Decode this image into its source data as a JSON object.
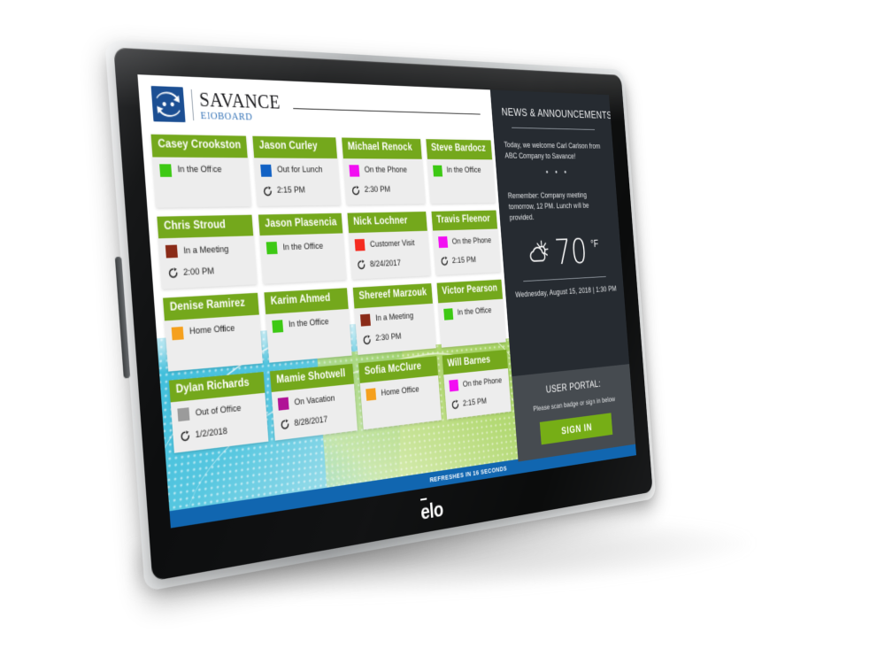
{
  "device": {
    "brand_logo": "elo-logo",
    "bezel_color": "#111213",
    "chassis_color": "#c9ccce"
  },
  "header": {
    "logo_icon": "savance-logo-icon",
    "brand": "SAVANCE",
    "product": "EIOBOARD"
  },
  "status_colors": {
    "in_the_office": "#3dc914",
    "out_for_lunch": "#1161c4",
    "on_the_phone": "#f20ef2",
    "in_a_meeting": "#8a2b18",
    "customer_visit": "#f52b20",
    "home_office": "#f5a01e",
    "out_of_office": "#9b9b9b",
    "on_vacation": "#b01396",
    "card_header_green": "#74a81c",
    "accent_blue": "#1166b0",
    "signin_green": "#76ae16"
  },
  "board": {
    "cards": [
      {
        "name": "Casey Crookston",
        "status": "In the Office",
        "status_color": "#3dc914",
        "time": ""
      },
      {
        "name": "Jason Curley",
        "status": "Out for Lunch",
        "status_color": "#1161c4",
        "time": "2:15 PM"
      },
      {
        "name": "Michael Renock",
        "status": "On the Phone",
        "status_color": "#f20ef2",
        "time": "2:30 PM"
      },
      {
        "name": "Steve Bardocz",
        "status": "In the Office",
        "status_color": "#3dc914",
        "time": ""
      },
      {
        "name": "Chris Stroud",
        "status": "In a Meeting",
        "status_color": "#8a2b18",
        "time": "2:00 PM"
      },
      {
        "name": "Jason Plasencia",
        "status": "In the Office",
        "status_color": "#3dc914",
        "time": ""
      },
      {
        "name": "Nick Lochner",
        "status": "Customer Visit",
        "status_color": "#f52b20",
        "time": "8/24/2017"
      },
      {
        "name": "Travis Fleenor",
        "status": "On the Phone",
        "status_color": "#f20ef2",
        "time": "2:15 PM"
      },
      {
        "name": "Denise Ramirez",
        "status": "Home Office",
        "status_color": "#f5a01e",
        "time": ""
      },
      {
        "name": "Karim Ahmed",
        "status": "In the Office",
        "status_color": "#3dc914",
        "time": ""
      },
      {
        "name": "Shereef Marzouk",
        "status": "In a Meeting",
        "status_color": "#8a2b18",
        "time": "2:30 PM"
      },
      {
        "name": "Victor Pearson",
        "status": "In the Office",
        "status_color": "#3dc914",
        "time": ""
      },
      {
        "name": "Dylan Richards",
        "status": "Out of Office",
        "status_color": "#9b9b9b",
        "time": "1/2/2018"
      },
      {
        "name": "Mamie Shotwell",
        "status": "On Vacation",
        "status_color": "#b01396",
        "time": "8/28/2017"
      },
      {
        "name": "Sofia McClure",
        "status": "Home Office",
        "status_color": "#f5a01e",
        "time": ""
      },
      {
        "name": "Will Barnes",
        "status": "On the Phone",
        "status_color": "#f20ef2",
        "time": "2:15 PM"
      }
    ],
    "refresh_text": "REFRESHES IN 16 SECONDS"
  },
  "sidebar": {
    "news": {
      "title": "NEWS & ANNOUNCEMENTS:",
      "item_1": "Today, we welcome Carl Carlson from ABC Company to Savance!",
      "separator": "• • •",
      "item_2": "Remember: Company meeting tomorrow, 12 PM. Lunch will be provided."
    },
    "weather": {
      "icon": "partly-cloudy-icon",
      "temperature": "70",
      "unit": "°F"
    },
    "datetime": "Wednesday, August 15, 2018 | 1:30 PM",
    "portal": {
      "title": "USER PORTAL:",
      "subtitle": "Please scan badge or sign in below",
      "signin_label": "SIGN IN"
    }
  }
}
